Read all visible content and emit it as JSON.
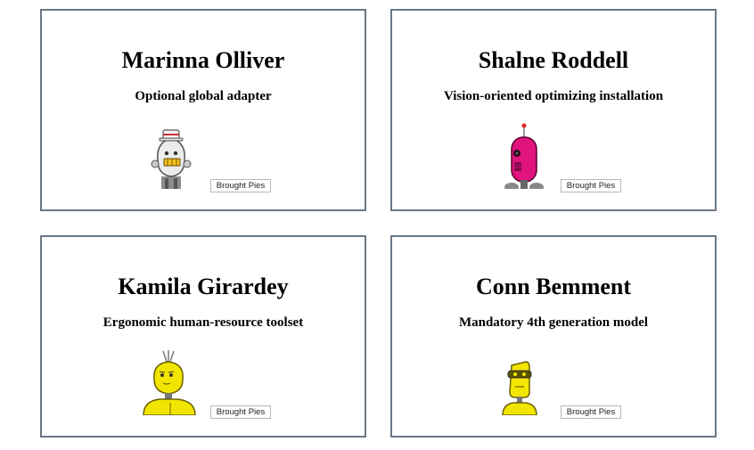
{
  "cards": [
    {
      "name": "Marinna Olliver",
      "tagline": "Optional global adapter",
      "button_label": "Brought Pies",
      "avatar_icon": "white-robot-avatar-icon",
      "avatar_color": "#e8e8e8"
    },
    {
      "name": "Shalne Roddell",
      "tagline": "Vision-oriented optimizing installation",
      "button_label": "Brought Pies",
      "avatar_icon": "pink-robot-avatar-icon",
      "avatar_color": "#e0147c"
    },
    {
      "name": "Kamila Girardey",
      "tagline": "Ergonomic human-resource toolset",
      "button_label": "Brought Pies",
      "avatar_icon": "yellow-robot-avatar-icon",
      "avatar_color": "#f2e600"
    },
    {
      "name": "Conn Bemment",
      "tagline": "Mandatory 4th generation model",
      "button_label": "Brought Pies",
      "avatar_icon": "yellow-robot-avatar-icon",
      "avatar_color": "#f2e600"
    }
  ]
}
